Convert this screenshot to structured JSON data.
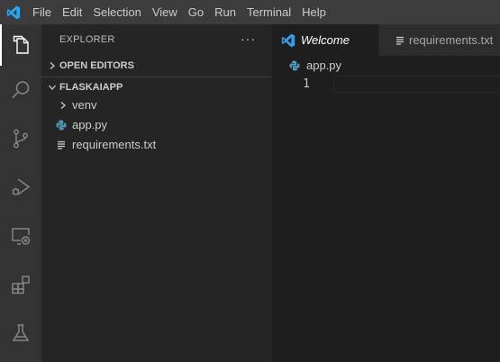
{
  "titlebar": {
    "logo_icon": "vscode-logo-icon",
    "menu": [
      "File",
      "Edit",
      "Selection",
      "View",
      "Go",
      "Run",
      "Terminal",
      "Help"
    ]
  },
  "activity_bar": {
    "items": [
      {
        "icon": "files-icon",
        "active": true
      },
      {
        "icon": "search-icon",
        "active": false
      },
      {
        "icon": "source-control-icon",
        "active": false
      },
      {
        "icon": "run-debug-icon",
        "active": false
      },
      {
        "icon": "remote-explorer-icon",
        "active": false
      },
      {
        "icon": "extensions-icon",
        "active": false
      },
      {
        "icon": "testing-icon",
        "active": false
      }
    ]
  },
  "sidebar": {
    "title": "EXPLORER",
    "more_label": "···",
    "sections": {
      "open_editors": {
        "label": "OPEN EDITORS",
        "expanded": false
      },
      "project": {
        "label": "FLASKAIAPP",
        "expanded": true
      }
    },
    "tree": [
      {
        "label": "venv",
        "kind": "folder",
        "icon": "chevron-right-icon"
      },
      {
        "label": "app.py",
        "kind": "file",
        "icon": "python-file-icon"
      },
      {
        "label": "requirements.txt",
        "kind": "file",
        "icon": "text-file-icon"
      }
    ]
  },
  "editor": {
    "tabs": [
      {
        "label": "Welcome",
        "icon": "vscode-logo-icon",
        "active": true,
        "italic": true
      },
      {
        "label": "requirements.txt",
        "icon": "text-file-icon",
        "active": false,
        "italic": false
      }
    ],
    "breadcrumb": {
      "label": "app.py",
      "icon": "python-file-icon"
    },
    "lines": [
      {
        "number": "1",
        "text": ""
      }
    ]
  },
  "colors": {
    "titlebar_bg": "#3c3c3c",
    "activitybar_bg": "#333333",
    "sidebar_bg": "#252526",
    "editor_bg": "#1e1e1e",
    "vscode_blue": "#0078d4",
    "python_blue": "#519aba"
  }
}
